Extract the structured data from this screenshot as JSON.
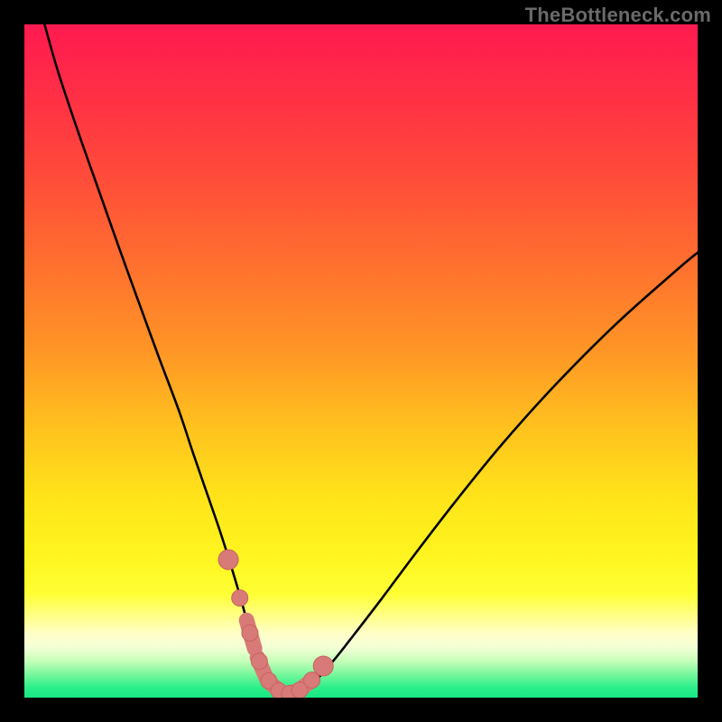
{
  "watermark": "TheBottleneck.com",
  "colors": {
    "black": "#000000",
    "curve": "#000000",
    "marker_fill": "#d87a78",
    "marker_stroke": "#c76360",
    "gradient_stops": [
      {
        "offset": 0.0,
        "color": "#ff1a50"
      },
      {
        "offset": 0.1,
        "color": "#ff2e46"
      },
      {
        "offset": 0.22,
        "color": "#ff4a3a"
      },
      {
        "offset": 0.35,
        "color": "#ff6e2f"
      },
      {
        "offset": 0.48,
        "color": "#ff9426"
      },
      {
        "offset": 0.6,
        "color": "#ffc21e"
      },
      {
        "offset": 0.7,
        "color": "#ffe31a"
      },
      {
        "offset": 0.78,
        "color": "#fff31e"
      },
      {
        "offset": 0.845,
        "color": "#ffff33"
      },
      {
        "offset": 0.88,
        "color": "#ffff8a"
      },
      {
        "offset": 0.905,
        "color": "#ffffc9"
      },
      {
        "offset": 0.925,
        "color": "#f4ffd6"
      },
      {
        "offset": 0.945,
        "color": "#c8ffba"
      },
      {
        "offset": 0.965,
        "color": "#79f79d"
      },
      {
        "offset": 0.985,
        "color": "#2bef8a"
      },
      {
        "offset": 1.0,
        "color": "#17e784"
      }
    ]
  },
  "chart_data": {
    "type": "line",
    "title": "",
    "xlabel": "",
    "ylabel": "",
    "xlim": [
      0,
      100
    ],
    "ylim": [
      0,
      100
    ],
    "grid": false,
    "series": [
      {
        "name": "bottleneck-curve",
        "x": [
          3,
          5,
          8,
          11,
          14,
          17,
          20,
          23,
          25,
          27,
          29,
          30.5,
          32,
          33.3,
          34.5,
          35.8,
          37.3,
          39,
          41,
          43.5,
          46,
          49,
          53,
          58,
          64,
          71,
          79,
          88,
          97,
          100
        ],
        "values": [
          100,
          93,
          84,
          75.5,
          67,
          58.7,
          50.5,
          42.5,
          36.5,
          30.7,
          24.9,
          20.2,
          15.2,
          10.5,
          6.5,
          3.4,
          1.4,
          0.55,
          1.0,
          2.8,
          5.6,
          9.4,
          14.6,
          21.3,
          29.1,
          37.7,
          46.6,
          55.6,
          63.6,
          66.1
        ]
      }
    ],
    "markers": {
      "name": "highlighted-points",
      "x": [
        30.3,
        32.0,
        33.5,
        34.9,
        36.3,
        37.8,
        39.4,
        40.9,
        42.7,
        44.4
      ],
      "values": [
        20.5,
        14.8,
        9.6,
        5.4,
        2.5,
        1.0,
        0.6,
        1.1,
        2.6,
        4.7
      ],
      "radius_big_idx": [
        0,
        9
      ],
      "bar_segments": [
        {
          "x1": 33.0,
          "y1": 11.5,
          "x2": 34.2,
          "y2": 7.3
        },
        {
          "x1": 34.6,
          "y1": 6.0,
          "x2": 35.9,
          "y2": 3.0
        },
        {
          "x1": 36.2,
          "y1": 2.4,
          "x2": 38.2,
          "y2": 0.8
        },
        {
          "x1": 38.6,
          "y1": 0.6,
          "x2": 40.3,
          "y2": 0.9
        },
        {
          "x1": 40.7,
          "y1": 1.0,
          "x2": 42.2,
          "y2": 2.2
        }
      ]
    }
  }
}
